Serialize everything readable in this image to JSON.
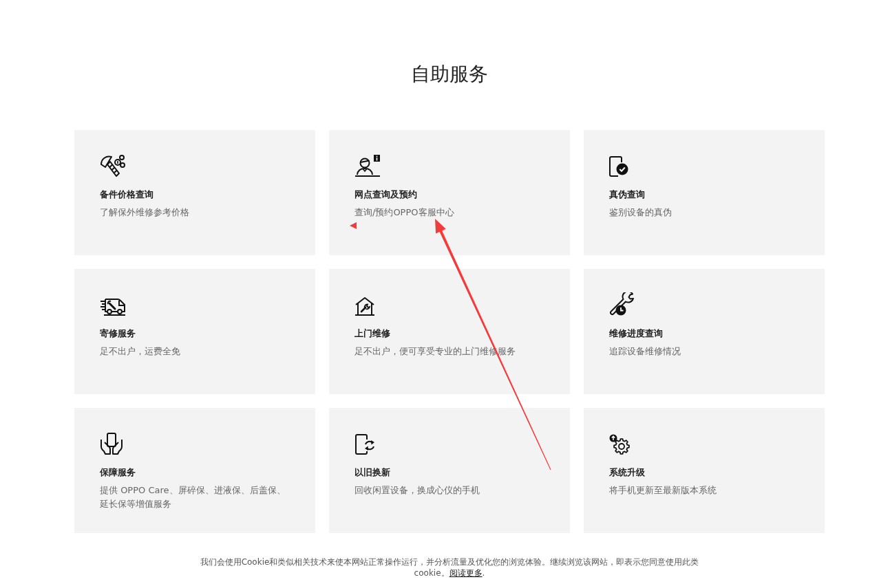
{
  "page": {
    "title": "自助服务"
  },
  "services": [
    {
      "title": "备件价格查询",
      "description": "了解保外维修参考价格"
    },
    {
      "title": "网点查询及预约",
      "description": "查询/预约OPPO客服中心"
    },
    {
      "title": "真伪查询",
      "description": "鉴别设备的真伪"
    },
    {
      "title": "寄修服务",
      "description": "足不出户，运费全免"
    },
    {
      "title": "上门维修",
      "description": "足不出户，便可享受专业的上门维修服务"
    },
    {
      "title": "维修进度查询",
      "description": "追踪设备维修情况"
    },
    {
      "title": "保障服务",
      "description": "提供 OPPO Care、屏碎保、进液保、后盖保、延长保等增值服务"
    },
    {
      "title": "以旧换新",
      "description": "回收闲置设备，换成心仪的手机"
    },
    {
      "title": "系统升级",
      "description": "将手机更新至最新版本系统"
    }
  ],
  "cookie_notice": {
    "text": "我们会使用Cookie和类似相关技术来使本网站正常操作运行，并分析流量及优化您的浏览体验。继续浏览该网站，即表示您同意使用此类cookie。",
    "link": "阅读更多",
    "tail": "."
  }
}
